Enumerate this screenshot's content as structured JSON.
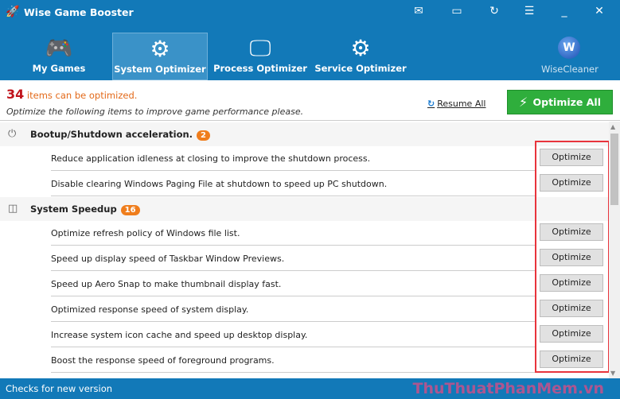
{
  "app": {
    "title": "Wise Game Booster"
  },
  "nav": {
    "tabs": [
      {
        "label": "My Games"
      },
      {
        "label": "System Optimizer"
      },
      {
        "label": "Process Optimizer"
      },
      {
        "label": "Service Optimizer"
      }
    ],
    "wisecleaner": "WiseCleaner",
    "wise_letter": "W"
  },
  "header": {
    "count": "34",
    "count_text": " items can be optimized.",
    "hint": "Optimize the following items to improve game performance please.",
    "resume_all": "Resume All",
    "optimize_all": "Optimize All"
  },
  "sections": [
    {
      "title": "Bootup/Shutdown acceleration.",
      "badge": "2",
      "items": [
        "Reduce application idleness at closing to improve the shutdown process.",
        "Disable clearing Windows Paging File at shutdown to speed up PC shutdown."
      ]
    },
    {
      "title": "System Speedup",
      "badge": "16",
      "items": [
        "Optimize refresh policy of Windows file list.",
        "Speed up display speed of Taskbar Window Previews.",
        "Speed up Aero Snap to make thumbnail display fast.",
        "Optimized response speed of system display.",
        "Increase system icon cache and speed up desktop display.",
        "Boost the response speed of foreground programs."
      ]
    }
  ],
  "optimize_label": "Optimize",
  "status": {
    "text": "Checks for new version",
    "watermark": "ThuThuatPhanMem.vn"
  }
}
